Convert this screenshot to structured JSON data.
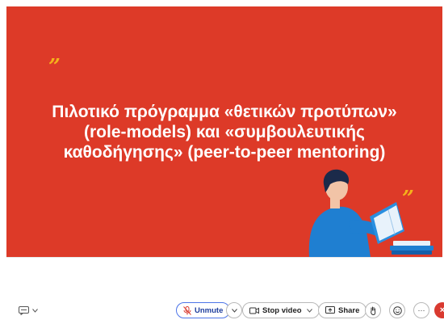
{
  "slide": {
    "quote_open": "”",
    "quote_close": "”",
    "title_lines": [
      "Πιλοτικό πρόγραμμα «θετικών προτύπων»",
      "(role-models) και «συμβουλευτικής",
      "καθοδήγησης» (peer-to-peer mentoring)"
    ],
    "colors": {
      "background": "#dd3a28",
      "accent": "#f5b21b",
      "text": "#ffffff"
    }
  },
  "toolbar": {
    "chat_icon": "chat-bubble-icon",
    "unmute_label": "Unmute",
    "stop_video_label": "Stop video",
    "share_label": "Share",
    "more_label": "···",
    "leave_label": "×",
    "colors": {
      "unmute_border": "#4d75e8",
      "leave": "#d93a30"
    }
  }
}
